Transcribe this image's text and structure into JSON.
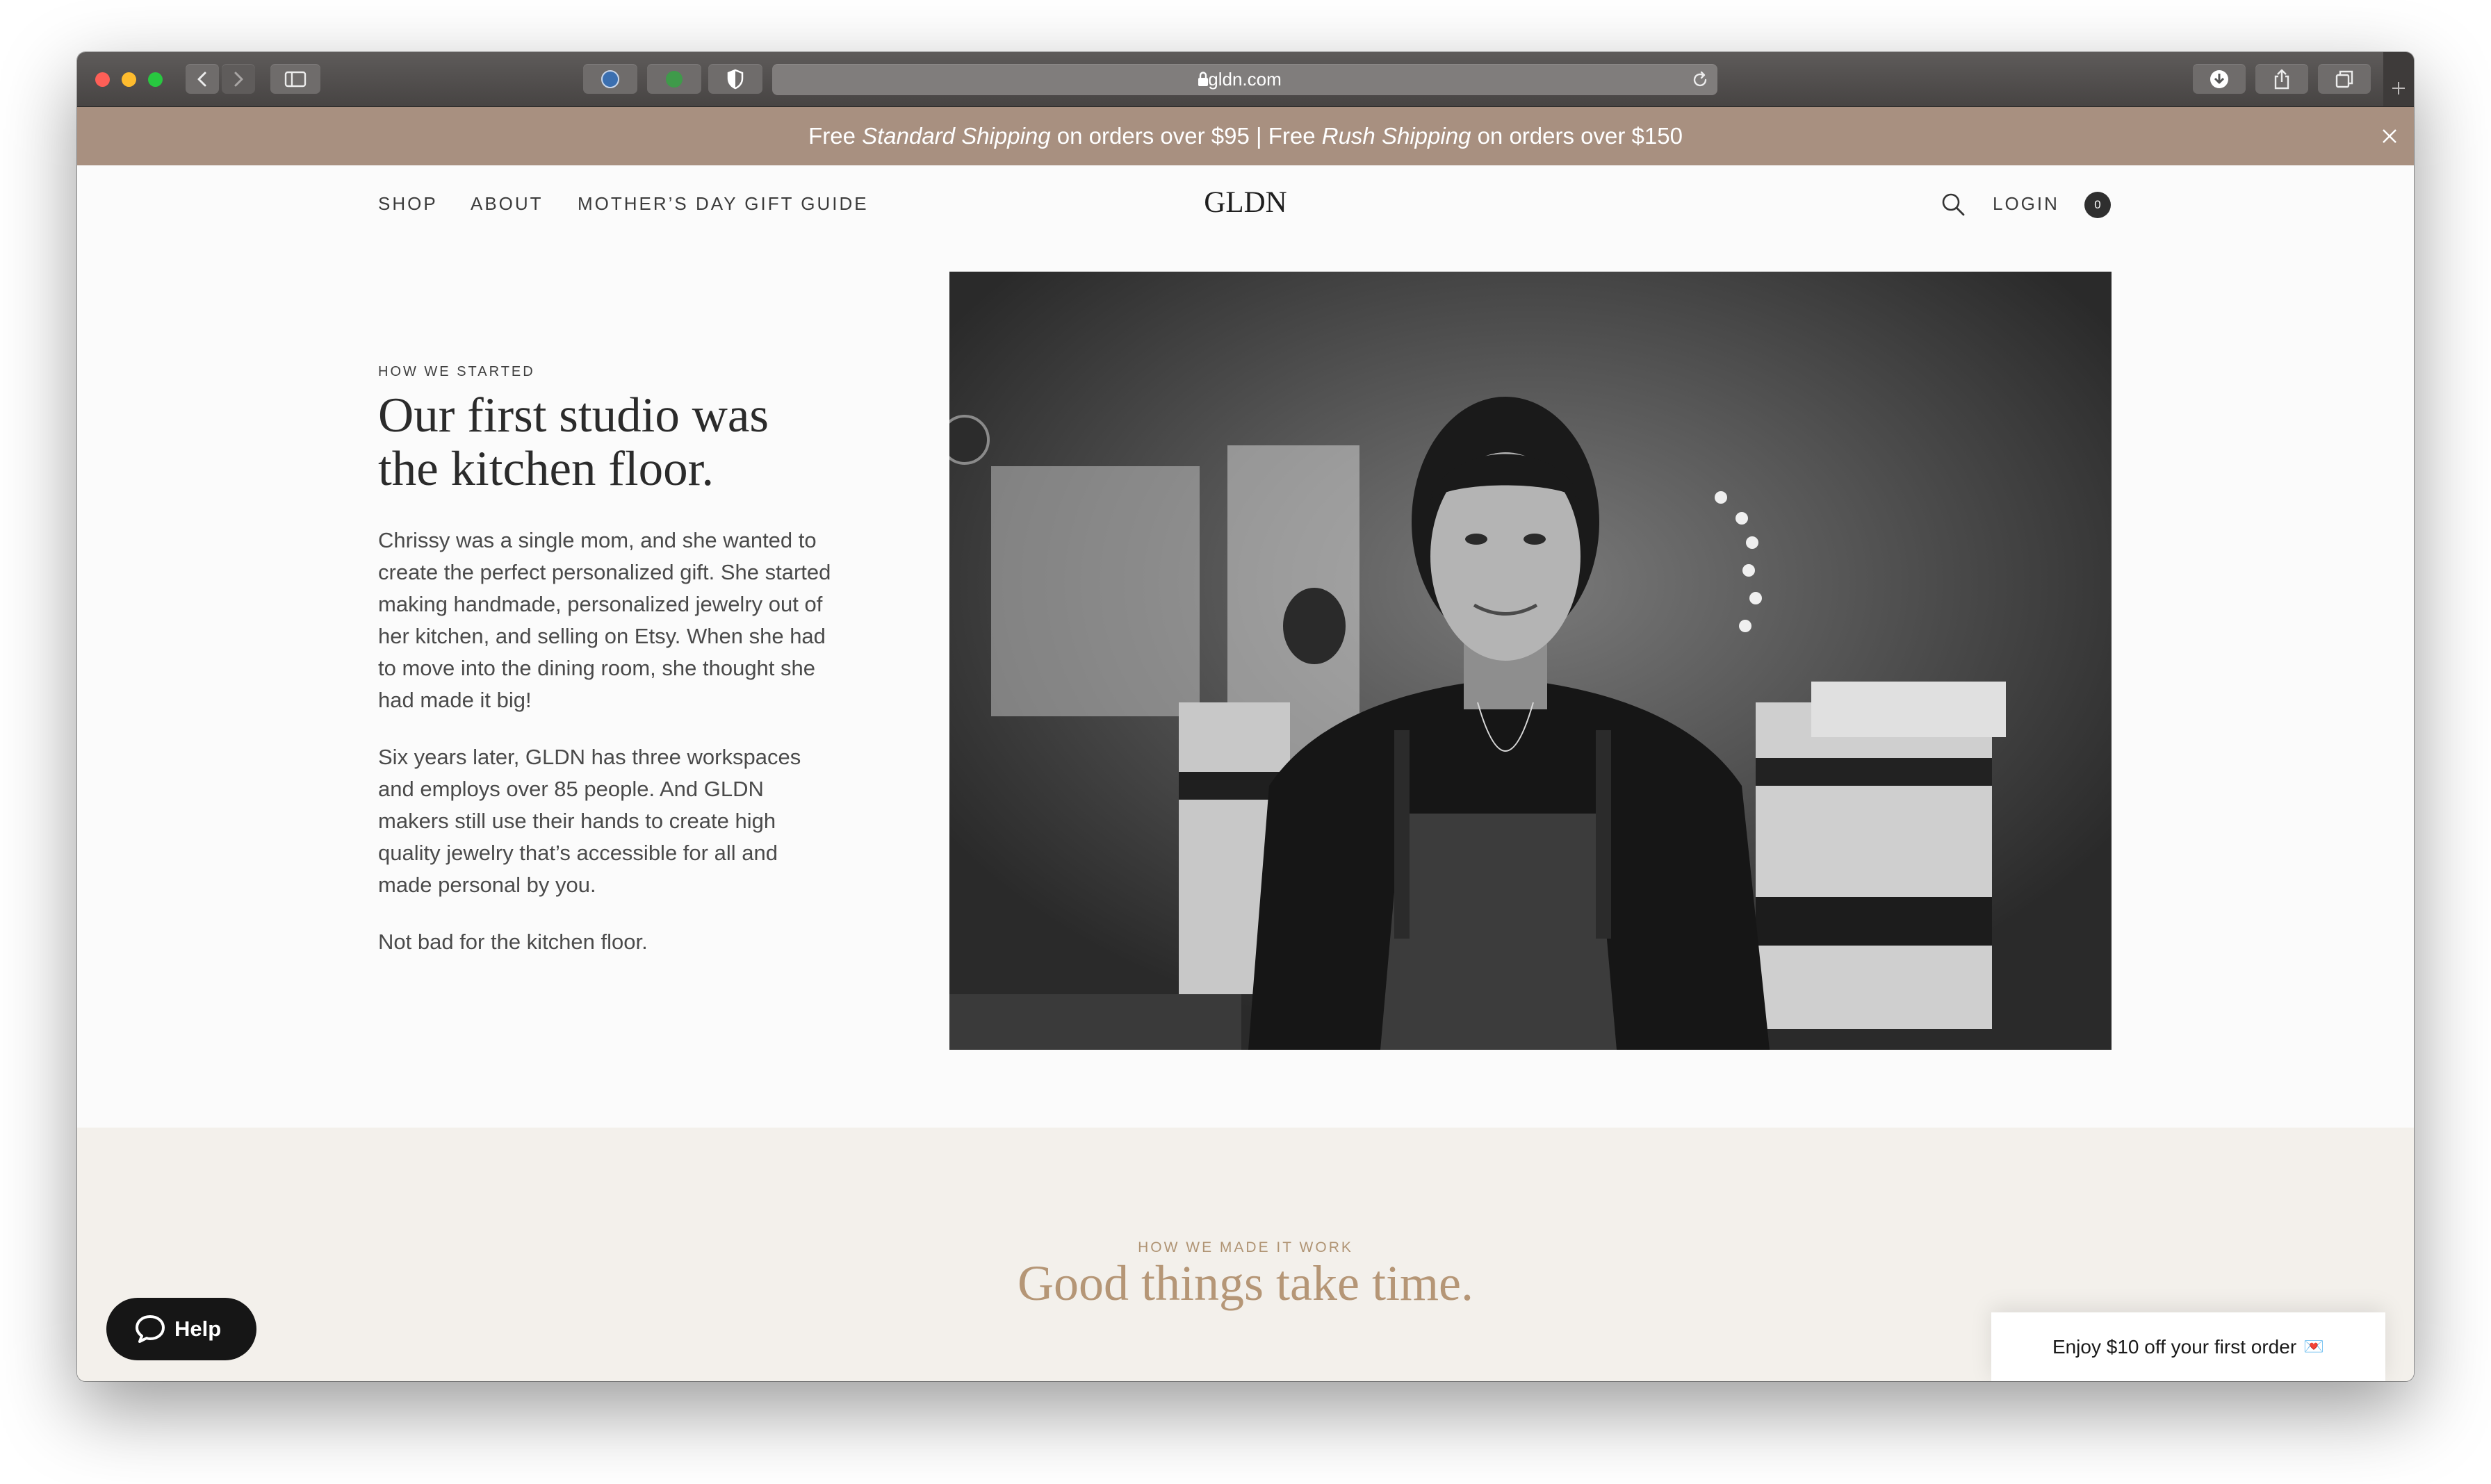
{
  "browser": {
    "url": "gldn.com"
  },
  "promo": {
    "part1": "Free ",
    "part2": "Standard Shipping",
    "part3": " on orders over $95 | Free ",
    "part4": "Rush Shipping",
    "part5": " on orders over $150"
  },
  "nav": {
    "shop": "SHOP",
    "about": "ABOUT",
    "gift_guide": "MOTHER’S DAY GIFT GUIDE",
    "logo": "GLDN",
    "login": "LOGIN",
    "cart_count": "0"
  },
  "story": {
    "eyebrow": "HOW WE STARTED",
    "headline_line1": "Our first studio was",
    "headline_line2": "the kitchen floor.",
    "paragraph1": "Chrissy was a single mom, and she wanted to create the perfect personalized gift. She started making handmade, personalized jewelry out of her kitchen, and selling on Etsy. When she had to move into the dining room, she thought she had made it big!",
    "paragraph2": "Six years later, GLDN has three workspaces and employs over 85 people. And GLDN makers still use their hands to create high quality jewelry that’s accessible for all and made personal by you.",
    "paragraph3": "Not bad for the kitchen floor."
  },
  "section2": {
    "eyebrow": "HOW WE MADE IT WORK",
    "title": "Good things take time."
  },
  "help": {
    "label": "Help"
  },
  "discount": {
    "text": "Enjoy $10 off your first order",
    "emoji": "💌"
  },
  "colors": {
    "promo_bg": "#a89080",
    "band_bg": "#f3f0eb",
    "accent_gold": "#b59676",
    "help_bg": "#161616"
  }
}
